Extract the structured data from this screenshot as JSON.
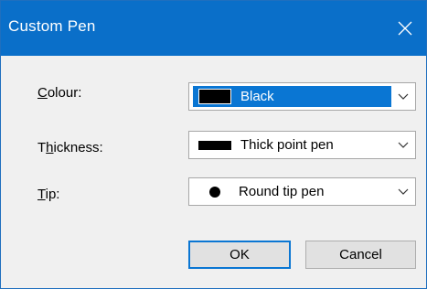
{
  "window": {
    "title": "Custom Pen",
    "close_icon": "close-icon"
  },
  "fields": {
    "colour": {
      "label_prefix": "",
      "label_accel": "C",
      "label_rest": "olour:",
      "value": "Black"
    },
    "thickness": {
      "label_prefix": "T",
      "label_accel": "h",
      "label_rest": "ickness:",
      "value": "Thick point pen"
    },
    "tip": {
      "label_prefix": "",
      "label_accel": "T",
      "label_rest": "ip:",
      "value": "Round tip pen"
    }
  },
  "buttons": {
    "ok": "OK",
    "cancel": "Cancel"
  },
  "colors": {
    "titlebar": "#0a6fc9",
    "selection": "#0a76d3",
    "dialog_bg": "#f0f0f0"
  }
}
